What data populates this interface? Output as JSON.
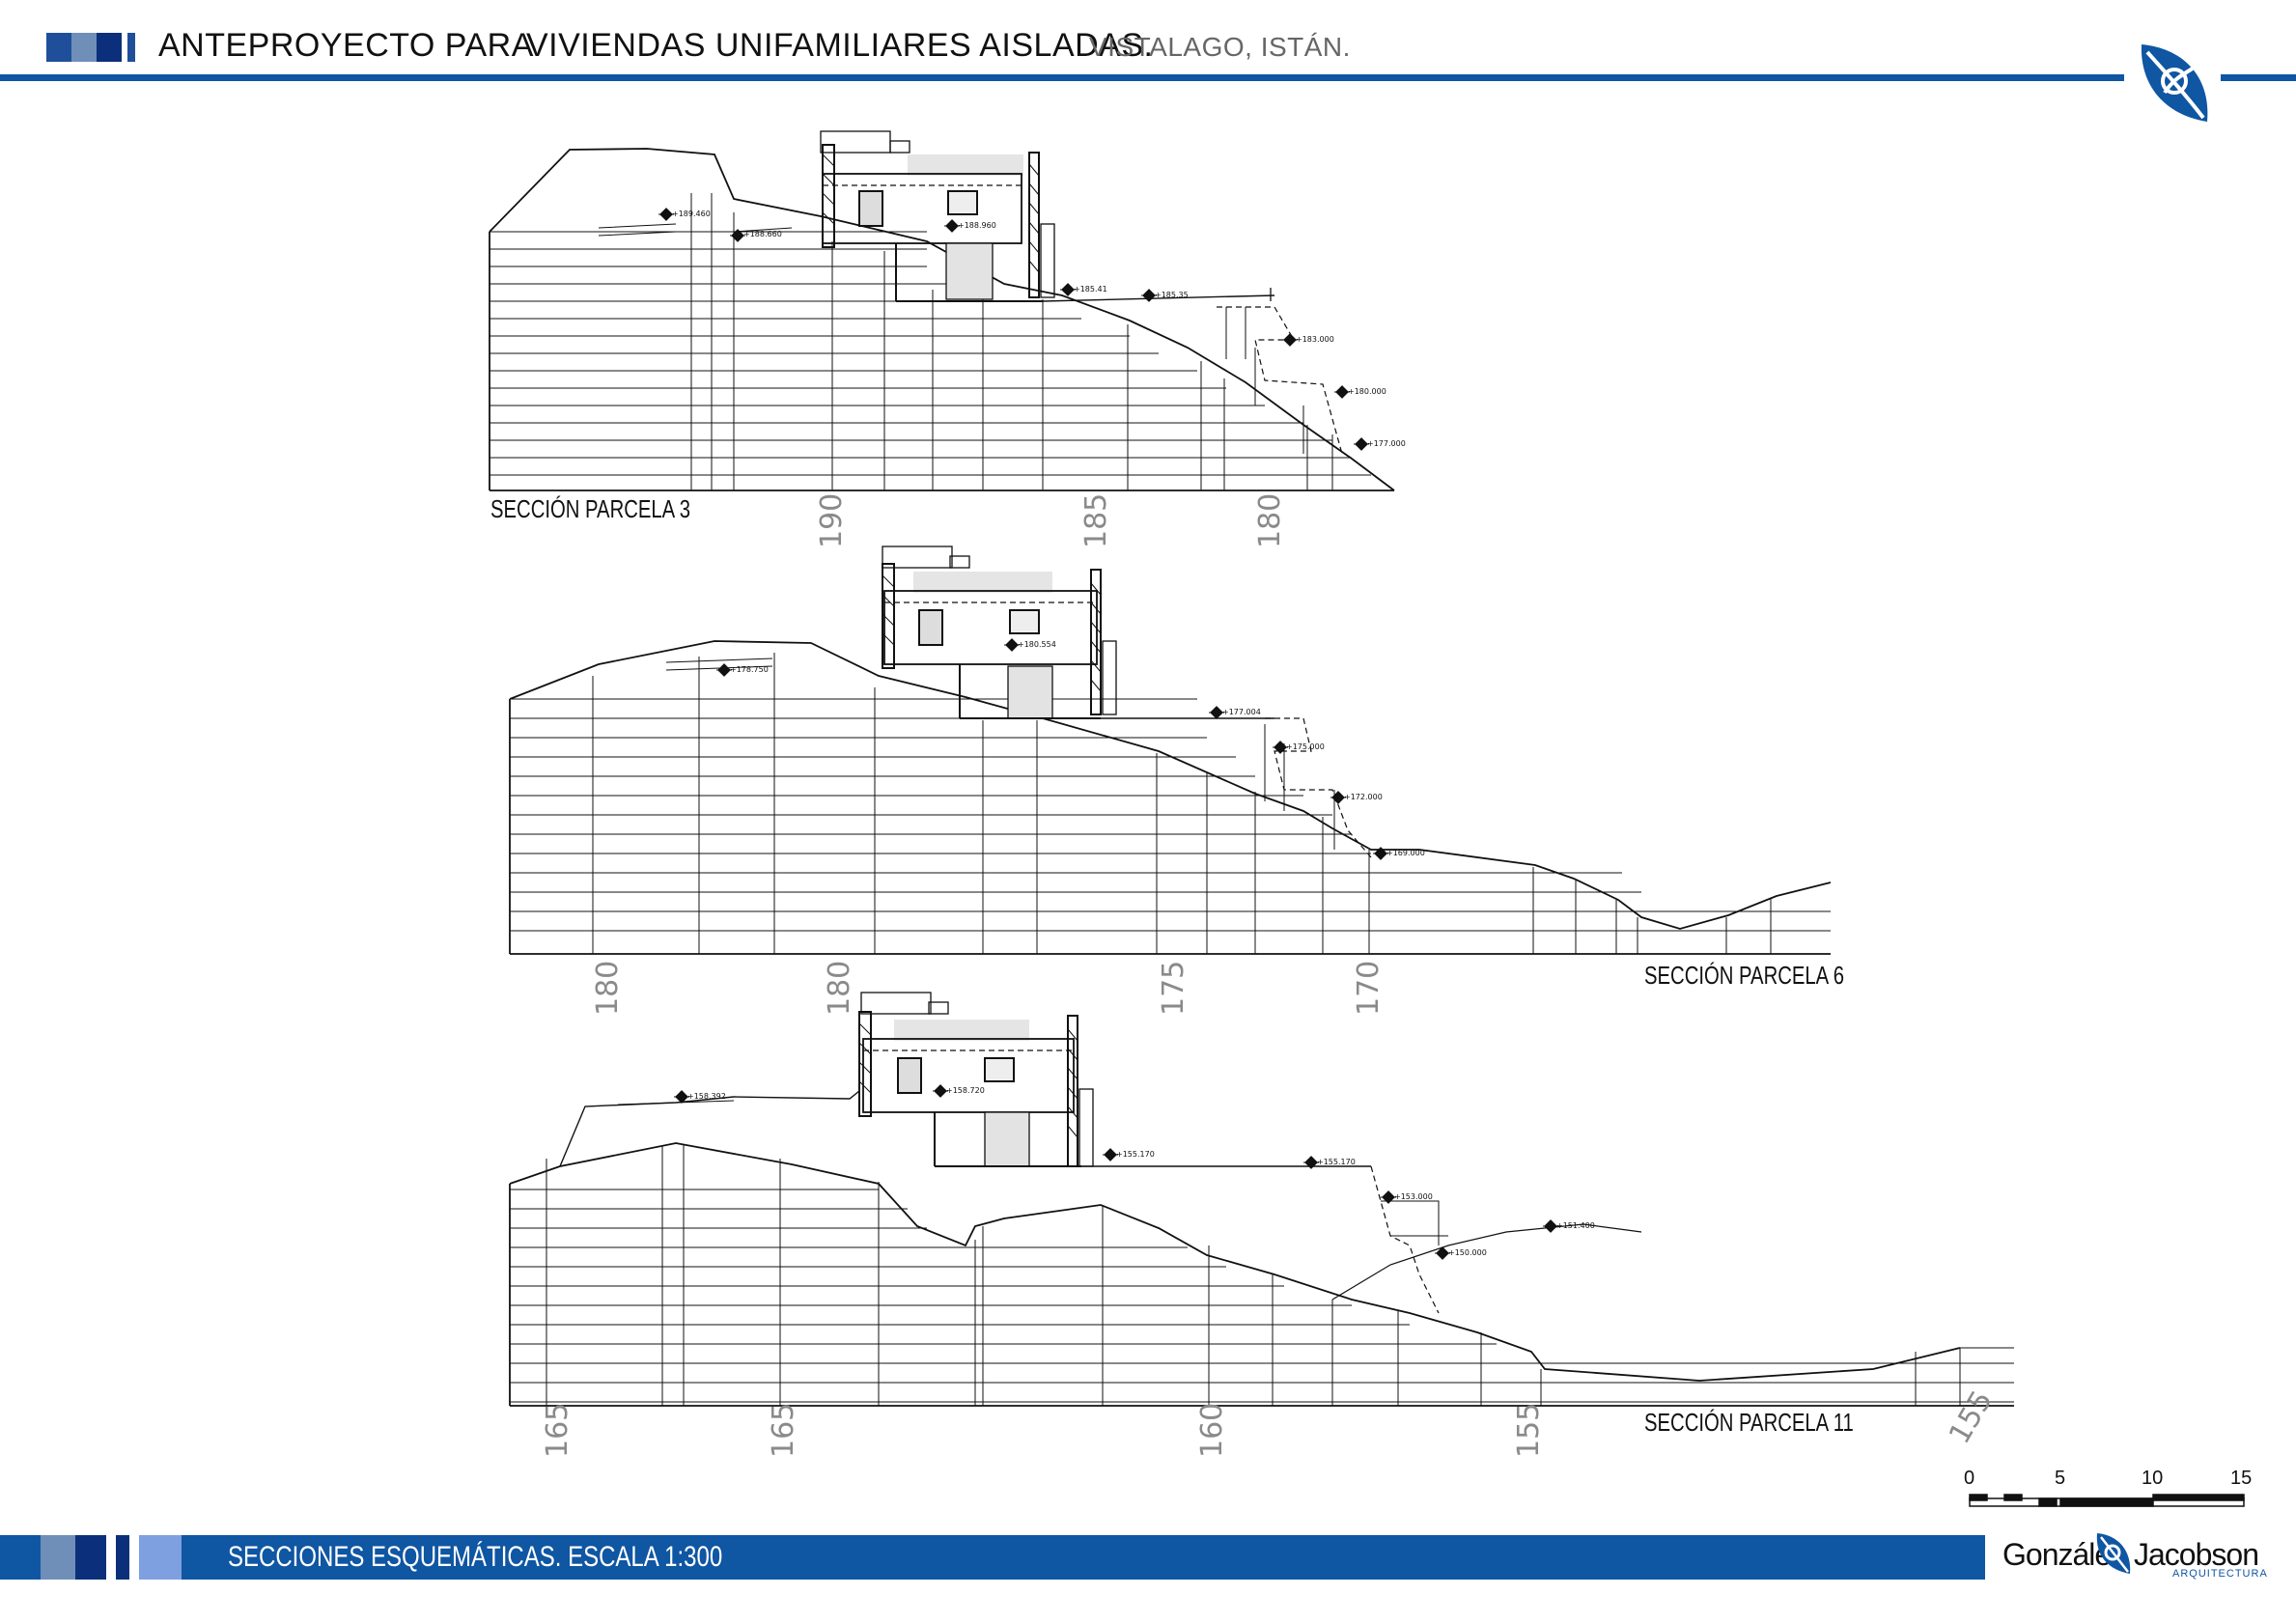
{
  "header": {
    "title_a": "ANTEPROYECTO PARA",
    "title_b": "VIVIENDAS UNIFAMILIARES AISLADAS.",
    "subtitle": "VISTALAGO, ISTÁN."
  },
  "sections": [
    {
      "label": "SECCIÓN PARCELA 3",
      "levels": [
        "+189.460",
        "+188.660",
        "+188.960",
        "+185.41",
        "+185.35",
        "+183.000",
        "+180.000",
        "+177.000"
      ],
      "ticks": [
        "190",
        "185",
        "180"
      ]
    },
    {
      "label": "SECCIÓN PARCELA 6",
      "levels": [
        "+178.750",
        "+180.554",
        "+177.004",
        "+175.000",
        "+172.000",
        "+169.000"
      ],
      "ticks": [
        "180",
        "180",
        "175",
        "170"
      ]
    },
    {
      "label": "SECCIÓN PARCELA 11",
      "levels": [
        "+158.392",
        "+158.720",
        "+155.170",
        "+155.170",
        "+153.000",
        "+150.000",
        "+151.400"
      ],
      "ticks": [
        "165",
        "165",
        "160",
        "155",
        "155"
      ]
    }
  ],
  "scale_bar": {
    "labels": [
      "0",
      "5",
      "10",
      "15"
    ]
  },
  "footer": {
    "text": "SECCIONES ESQUEMÁTICAS.  ESCALA 1:300",
    "logo_a": "González",
    "logo_b": "Jacobson",
    "logo_sub": "ARQUITECTURA"
  },
  "colors": {
    "brand_blue": "#0f56a3",
    "navy": "#0b2f7a",
    "steel": "#5a7fa8",
    "light_blue": "#7fa0e0"
  }
}
